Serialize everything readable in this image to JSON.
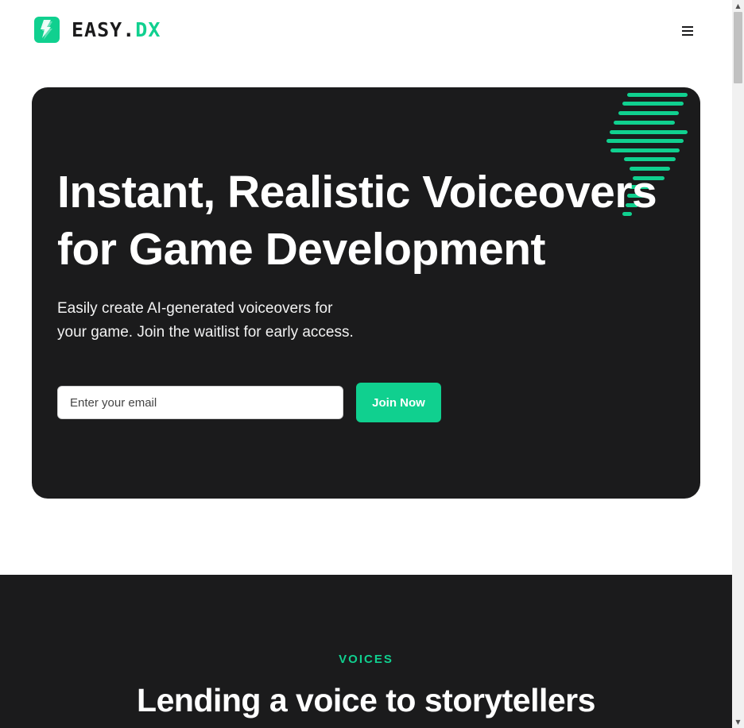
{
  "header": {
    "brand_main": "EASY.",
    "brand_accent": "DX",
    "logo_icon": "lightning-bolt-icon",
    "menu_icon": "hamburger-menu-icon"
  },
  "hero": {
    "title_line1": "Instant, Realistic Voiceovers",
    "title_line2": "for Game Development",
    "subtitle_line1": "Easily create AI-generated voiceovers for",
    "subtitle_line2": "your game. Join the waitlist for early access.",
    "email_placeholder": "Enter your email",
    "join_label": "Join Now"
  },
  "voices": {
    "eyebrow": "VOICES",
    "title": "Lending a voice to storytellers"
  },
  "colors": {
    "accent": "#10d08f",
    "dark": "#1b1b1c",
    "background": "#ffffff"
  }
}
